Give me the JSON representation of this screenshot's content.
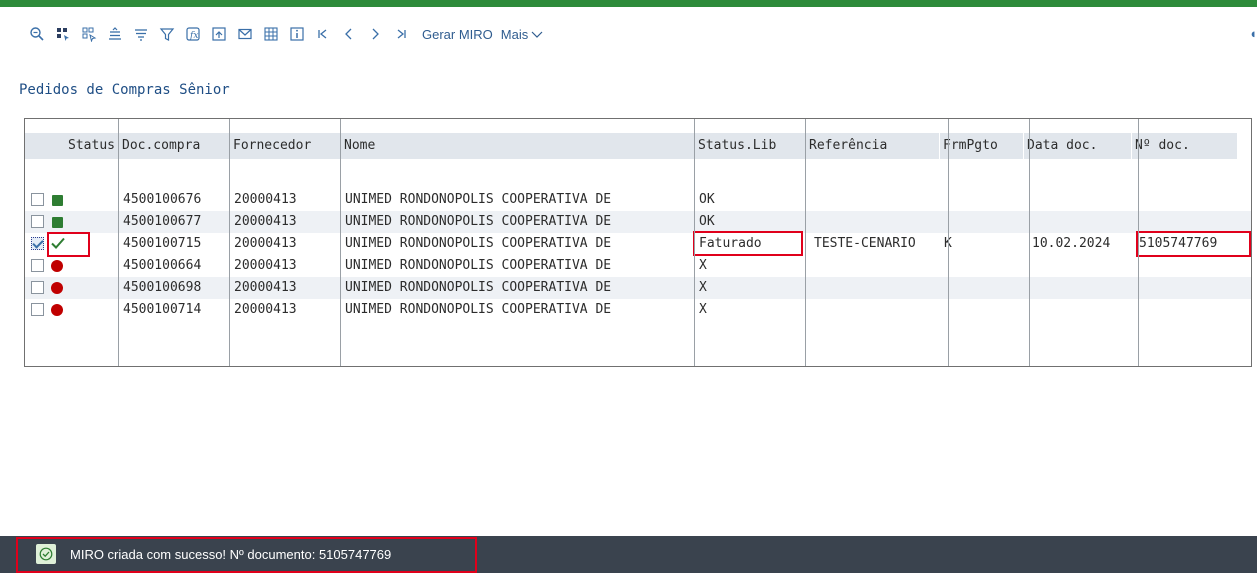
{
  "toolbar": {
    "icons": [
      "zoom-icon",
      "select-all-icon",
      "deselect-all-icon",
      "sort-ascending-icon",
      "sort-descending-icon",
      "filter-icon",
      "total-icon",
      "export-icon",
      "mail-icon",
      "spreadsheet-icon",
      "info-icon",
      "first-page-icon",
      "previous-page-icon",
      "next-page-icon",
      "last-page-icon"
    ],
    "gerar_miro_label": "Gerar MIRO",
    "mais_label": "Mais"
  },
  "page_title": "Pedidos de Compras Sênior",
  "table": {
    "columns": [
      "Status",
      "Doc.compra",
      "Fornecedor",
      "Nome",
      "Status.Lib",
      "Referência",
      "FrmPgto",
      "Data doc.",
      "Nº doc."
    ],
    "rows": [
      {
        "checked": false,
        "status_icon": "green-square-icon",
        "doc_compra": "4500100676",
        "fornecedor": "20000413",
        "nome": "UNIMED RONDONOPOLIS COOPERATIVA DE",
        "status_lib": "OK",
        "referencia": "",
        "frmpgto": "",
        "data_doc": "",
        "n_doc": ""
      },
      {
        "checked": false,
        "status_icon": "green-square-icon",
        "doc_compra": "4500100677",
        "fornecedor": "20000413",
        "nome": "UNIMED RONDONOPOLIS COOPERATIVA DE",
        "status_lib": "OK",
        "referencia": "",
        "frmpgto": "",
        "data_doc": "",
        "n_doc": ""
      },
      {
        "checked": true,
        "status_icon": "checkmark-icon",
        "doc_compra": "4500100715",
        "fornecedor": "20000413",
        "nome": "UNIMED RONDONOPOLIS COOPERATIVA DE",
        "status_lib": "Faturado",
        "referencia": "TESTE-CENARIO",
        "frmpgto": "K",
        "data_doc": "10.02.2024",
        "n_doc": "5105747769"
      },
      {
        "checked": false,
        "status_icon": "red-circle-icon",
        "doc_compra": "4500100664",
        "fornecedor": "20000413",
        "nome": "UNIMED RONDONOPOLIS COOPERATIVA DE",
        "status_lib": "X",
        "referencia": "",
        "frmpgto": "",
        "data_doc": "",
        "n_doc": ""
      },
      {
        "checked": false,
        "status_icon": "red-circle-icon",
        "doc_compra": "4500100698",
        "fornecedor": "20000413",
        "nome": "UNIMED RONDONOPOLIS COOPERATIVA DE",
        "status_lib": "X",
        "referencia": "",
        "frmpgto": "",
        "data_doc": "",
        "n_doc": ""
      },
      {
        "checked": false,
        "status_icon": "red-circle-icon",
        "doc_compra": "4500100714",
        "fornecedor": "20000413",
        "nome": "UNIMED RONDONOPOLIS COOPERATIVA DE",
        "status_lib": "X",
        "referencia": "",
        "frmpgto": "",
        "data_doc": "",
        "n_doc": ""
      }
    ]
  },
  "status_bar": {
    "message": "MIRO criada com sucesso! Nº documento: 5105747769",
    "icon": "success-check-icon"
  },
  "colors": {
    "top_accent": "#2e8b3a",
    "status_bar_bg": "#3a434e",
    "highlight_border": "#e0001b",
    "link_blue": "#2f5c8f",
    "ok_green": "#2e7d32",
    "error_red": "#c00000"
  }
}
